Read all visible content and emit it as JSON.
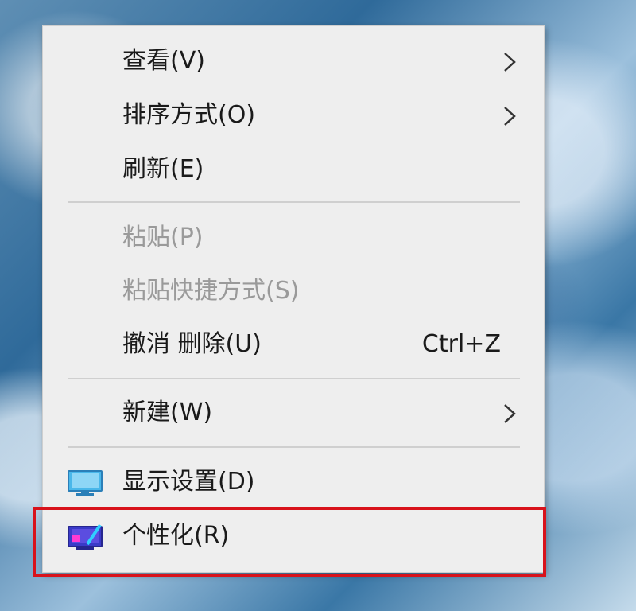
{
  "context_menu": {
    "items": [
      {
        "label": "查看(V)",
        "submenu": true,
        "enabled": true
      },
      {
        "label": "排序方式(O)",
        "submenu": true,
        "enabled": true
      },
      {
        "label": "刷新(E)",
        "submenu": false,
        "enabled": true
      },
      {
        "label": "粘贴(P)",
        "submenu": false,
        "enabled": false
      },
      {
        "label": "粘贴快捷方式(S)",
        "submenu": false,
        "enabled": false
      },
      {
        "label": "撤消 删除(U)",
        "shortcut": "Ctrl+Z",
        "enabled": true
      },
      {
        "label": "新建(W)",
        "submenu": true,
        "enabled": true
      },
      {
        "label": "显示设置(D)",
        "icon": "display-settings-icon",
        "enabled": true
      },
      {
        "label": "个性化(R)",
        "icon": "personalize-icon",
        "enabled": true,
        "highlighted": true
      }
    ]
  },
  "colors": {
    "menu_background": "#eeeeee",
    "highlight_border": "#d8121b",
    "disabled_text": "#9a9a9a"
  }
}
